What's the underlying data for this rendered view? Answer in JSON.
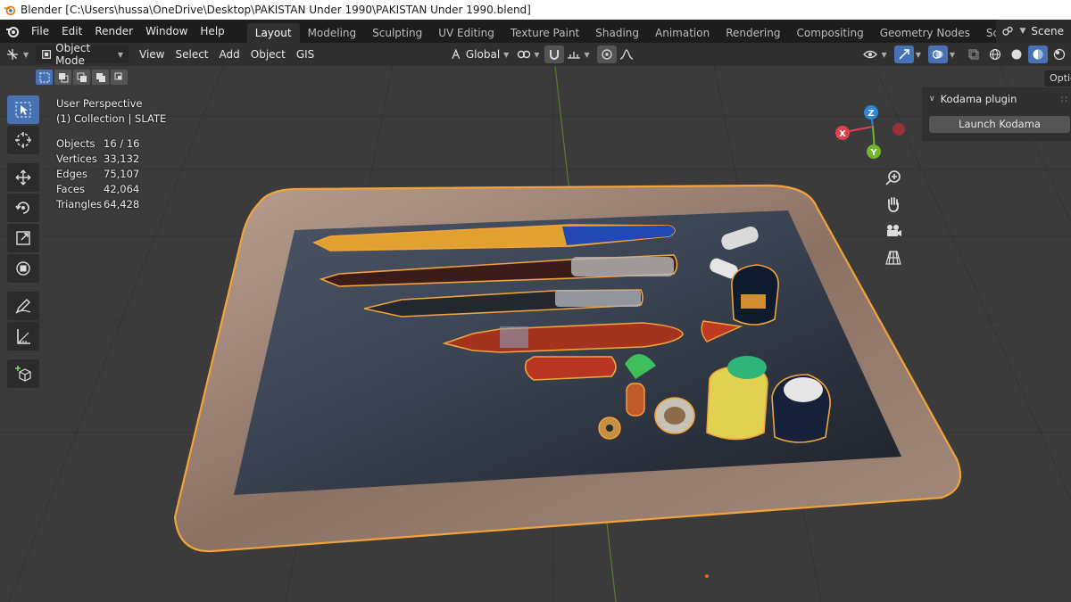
{
  "window": {
    "title": "Blender [C:\\Users\\hussa\\OneDrive\\Desktop\\PAKISTAN Under 1990\\PAKISTAN Under 1990.blend]"
  },
  "menu": {
    "items": [
      "File",
      "Edit",
      "Render",
      "Window",
      "Help"
    ]
  },
  "workspaces": {
    "tabs": [
      "Layout",
      "Modeling",
      "Sculpting",
      "UV Editing",
      "Texture Paint",
      "Shading",
      "Animation",
      "Rendering",
      "Compositing",
      "Geometry Nodes",
      "Scripting"
    ],
    "active": "Layout",
    "add": "+"
  },
  "scene": {
    "label": "Scene"
  },
  "header": {
    "mode": "Object Mode",
    "menus": [
      "View",
      "Select",
      "Add",
      "Object",
      "GIS"
    ],
    "transform_orientation": "Global"
  },
  "viewport_overlay": {
    "perspective": "User Perspective",
    "collection": "(1) Collection | SLATE",
    "stats": [
      {
        "label": "Objects",
        "value": "16 / 16"
      },
      {
        "label": "Vertices",
        "value": "33,132"
      },
      {
        "label": "Edges",
        "value": "75,107"
      },
      {
        "label": "Faces",
        "value": "42,064"
      },
      {
        "label": "Triangles",
        "value": "64,428"
      }
    ]
  },
  "gizmo": {
    "x": "X",
    "y": "Y",
    "z": "Z",
    "colors": {
      "x": "#e0404f",
      "y": "#6fb729",
      "z": "#2f86d6"
    }
  },
  "sidebar": {
    "options": "Optio",
    "panel_title": "Kodama plugin",
    "launch_button": "Launch Kodama"
  },
  "colors": {
    "accent": "#4772b3",
    "selection_outline": "#f2a33a"
  }
}
